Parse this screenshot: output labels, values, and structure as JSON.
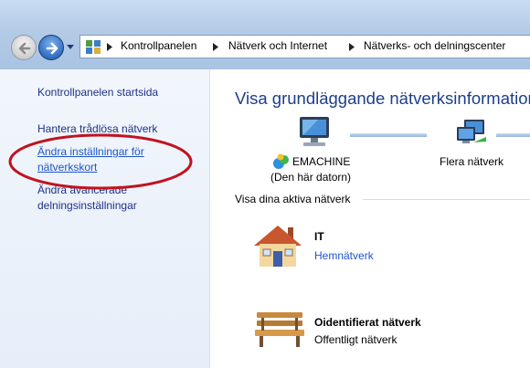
{
  "address_bar": {
    "breadcrumbs": [
      "Kontrollpanelen",
      "Nätverk och Internet",
      "Nätverks- och delningscenter"
    ]
  },
  "left_pane": {
    "home": "Kontrollpanelen startsida",
    "wireless": "Hantera trådlösa nätverk",
    "adapter_line1": "Ändra inställningar för",
    "adapter_line2": "nätverkskort",
    "sharing_line1": "Ändra avancerade",
    "sharing_line2": "delningsinställningar"
  },
  "main": {
    "heading": "Visa grundläggande nätverksinformation o",
    "map": {
      "computer_name": "EMACHINE",
      "computer_sub": "(Den här datorn)",
      "multiple_networks": "Flera nätverk"
    },
    "active_networks_title": "Visa dina aktiva nätverk",
    "networks": [
      {
        "name": "IT",
        "type": "Hemnätverk"
      },
      {
        "name": "Oidentifierat nätverk",
        "type": "Offentligt nätverk"
      }
    ]
  },
  "colors": {
    "link": "#1e55c8",
    "heading": "#1e3e8c",
    "highlight_ellipse": "#c0131f",
    "pane_background": "#eaf1fa"
  }
}
